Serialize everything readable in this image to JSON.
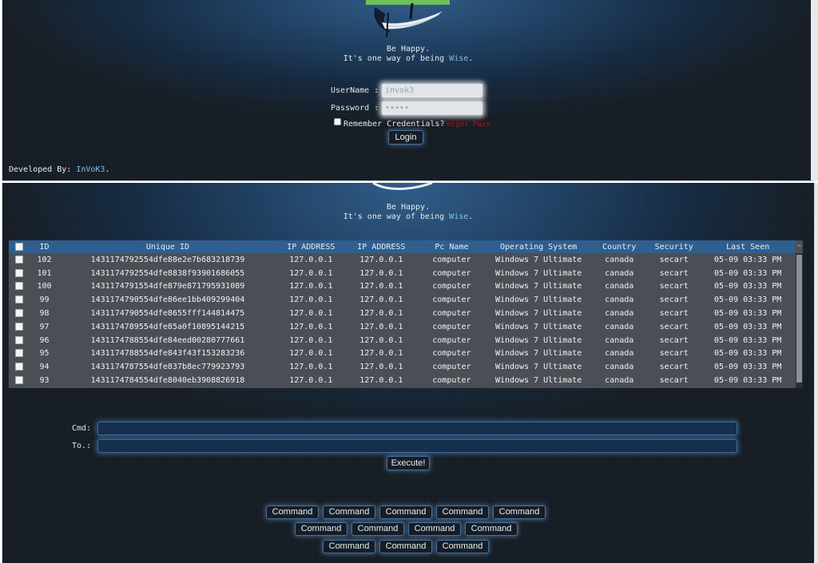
{
  "login_page": {
    "tagline_line1": "Be Happy.",
    "tagline_line2_prefix": "It's one way of being",
    "tagline_line2_highlight": "Wise",
    "tagline_line2_suffix": ".",
    "username_label": "UserName :",
    "username_value": "invok3",
    "password_label": "Password :",
    "password_value": "•••••",
    "remember_label": "Remember Credentials?",
    "forgot_label": "Forgot Pass",
    "login_button": "Login",
    "developed_by_prefix": "Developed By:",
    "developer_name": "InVoK3",
    "developed_by_suffix": "."
  },
  "panel": {
    "tagline_line1": "Be Happy.",
    "tagline_line2_prefix": "It's one way of being",
    "tagline_line2_highlight": "Wise",
    "tagline_line2_suffix": ".",
    "table": {
      "columns": [
        "ID",
        "Unique ID",
        "IP ADDRESS",
        "IP ADDRESS",
        "Pc Name",
        "Operating System",
        "Country",
        "Security",
        "Last Seen"
      ],
      "rows": [
        [
          "102",
          "1431174792554dfe88e2e7b683218739",
          "127.0.0.1",
          "127.0.0.1",
          "computer",
          "Windows 7 Ultimate",
          "canada",
          "secart",
          "05-09 03:33 PM"
        ],
        [
          "101",
          "1431174792554dfe8838f93901686055",
          "127.0.0.1",
          "127.0.0.1",
          "computer",
          "Windows 7 Ultimate",
          "canada",
          "secart",
          "05-09 03:33 PM"
        ],
        [
          "100",
          "1431174791554dfe879e871795931089",
          "127.0.0.1",
          "127.0.0.1",
          "computer",
          "Windows 7 Ultimate",
          "canada",
          "secart",
          "05-09 03:33 PM"
        ],
        [
          "99",
          "1431174790554dfe86ee1bb409299404",
          "127.0.0.1",
          "127.0.0.1",
          "computer",
          "Windows 7 Ultimate",
          "canada",
          "secart",
          "05-09 03:33 PM"
        ],
        [
          "98",
          "1431174790554dfe8655fff144814475",
          "127.0.0.1",
          "127.0.0.1",
          "computer",
          "Windows 7 Ultimate",
          "canada",
          "secart",
          "05-09 03:33 PM"
        ],
        [
          "97",
          "1431174789554dfe85a0f10895144215",
          "127.0.0.1",
          "127.0.0.1",
          "computer",
          "Windows 7 Ultimate",
          "canada",
          "secart",
          "05-09 03:33 PM"
        ],
        [
          "96",
          "1431174788554dfe84eed00280777661",
          "127.0.0.1",
          "127.0.0.1",
          "computer",
          "Windows 7 Ultimate",
          "canada",
          "secart",
          "05-09 03:33 PM"
        ],
        [
          "95",
          "1431174788554dfe843f43f153283236",
          "127.0.0.1",
          "127.0.0.1",
          "computer",
          "Windows 7 Ultimate",
          "canada",
          "secart",
          "05-09 03:33 PM"
        ],
        [
          "94",
          "1431174787554dfe837b8ec779923793",
          "127.0.0.1",
          "127.0.0.1",
          "computer",
          "Windows 7 Ultimate",
          "canada",
          "secart",
          "05-09 03:33 PM"
        ],
        [
          "93",
          "1431174784554dfe8040eb3908826918",
          "127.0.0.1",
          "127.0.0.1",
          "computer",
          "Windows 7 Ultimate",
          "canada",
          "secart",
          "05-09 03:33 PM"
        ]
      ]
    },
    "cmd_label": "Cmd:",
    "to_label": "To.:",
    "execute_button": "Execute!",
    "command_buttons": [
      "Command",
      "Command",
      "Command",
      "Command",
      "Command",
      "Command",
      "Command",
      "Command",
      "Command",
      "Command",
      "Command",
      "Command"
    ]
  },
  "colors": {
    "accent": "#7cc0ec",
    "table_header": "#2f5f8f",
    "forgot_link": "#b01919",
    "tab_marker": "#6ec05c"
  },
  "icons": [
    "logo-icon",
    "checkbox-icon"
  ]
}
